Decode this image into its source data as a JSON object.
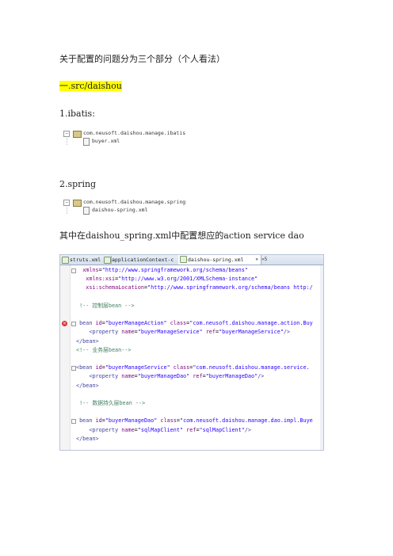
{
  "paragraphs": {
    "intro": "关于配置的问题分为三个部分（个人看法）",
    "section1": "一.src/daishou",
    "item1": "1.ibatis:",
    "item2": "2.spring",
    "note": "其中在daishou_spring.xml中配置想应的action service dao"
  },
  "ibatis_tree": {
    "package": "com.neusoft.daishou.manage.ibatis",
    "file": "buyer.xml"
  },
  "spring_tree": {
    "package": "com.neusoft.daishou.manage.spring",
    "file": "daishou-spring.xml"
  },
  "editor": {
    "tabs": [
      "struts.xml",
      "applicationContext-c",
      "daishou-spring.xml"
    ],
    "active_tab": 2,
    "overflow_count": "»5",
    "lines": [
      [
        {
          "c": "t-plain",
          "t": "  "
        },
        {
          "c": "t-attr",
          "t": "xmlns"
        },
        {
          "c": "t-plain",
          "t": "="
        },
        {
          "c": "t-val",
          "t": "\"http://www.springframework.org/schema/beans\""
        }
      ],
      [
        {
          "c": "t-plain",
          "t": "   "
        },
        {
          "c": "t-attr",
          "t": "xmlns:xsi"
        },
        {
          "c": "t-plain",
          "t": "="
        },
        {
          "c": "t-val",
          "t": "\"http://www.w3.org/2001/XMLSchema-instance\""
        }
      ],
      [
        {
          "c": "t-plain",
          "t": "   "
        },
        {
          "c": "t-attr",
          "t": "xsi:schemaLocation"
        },
        {
          "c": "t-plain",
          "t": "="
        },
        {
          "c": "t-val",
          "t": "\"http://www.springframework.org/schema/beans http:/"
        }
      ],
      [
        {
          "c": "t-plain",
          "t": ""
        }
      ],
      [
        {
          "c": "t-cmt",
          "t": " !-- 控制层bean -->"
        }
      ],
      [
        {
          "c": "t-plain",
          "t": ""
        }
      ],
      [
        {
          "c": "t-tag",
          "t": " bean "
        },
        {
          "c": "t-attr",
          "t": "id"
        },
        {
          "c": "t-plain",
          "t": "="
        },
        {
          "c": "t-val",
          "t": "\"buyerManageAction\""
        },
        {
          "c": "t-plain",
          "t": " "
        },
        {
          "c": "t-attr",
          "t": "class"
        },
        {
          "c": "t-plain",
          "t": "="
        },
        {
          "c": "t-val",
          "t": "\"com.neusoft.daishou.manage.action.Buy"
        }
      ],
      [
        {
          "c": "t-plain",
          "t": "    "
        },
        {
          "c": "t-tag",
          "t": "<property "
        },
        {
          "c": "t-attr",
          "t": "name"
        },
        {
          "c": "t-plain",
          "t": "="
        },
        {
          "c": "t-val",
          "t": "\"buyerManageService\""
        },
        {
          "c": "t-plain",
          "t": " "
        },
        {
          "c": "t-attr",
          "t": "ref"
        },
        {
          "c": "t-plain",
          "t": "="
        },
        {
          "c": "t-val",
          "t": "\"buyerManageService\""
        },
        {
          "c": "t-tag",
          "t": "/>"
        }
      ],
      [
        {
          "c": "t-tag",
          "t": "</bean>"
        }
      ],
      [
        {
          "c": "t-cmt",
          "t": "<!-- 业务层bean-->"
        }
      ],
      [
        {
          "c": "t-plain",
          "t": ""
        }
      ],
      [
        {
          "c": "t-tag",
          "t": "<bean "
        },
        {
          "c": "t-attr",
          "t": "id"
        },
        {
          "c": "t-plain",
          "t": "="
        },
        {
          "c": "t-val",
          "t": "\"buyerManageService\""
        },
        {
          "c": "t-plain",
          "t": " "
        },
        {
          "c": "t-attr",
          "t": "class"
        },
        {
          "c": "t-plain",
          "t": "="
        },
        {
          "c": "t-val",
          "t": "\"com.neusoft.daishou.manage.service."
        }
      ],
      [
        {
          "c": "t-plain",
          "t": "    "
        },
        {
          "c": "t-tag",
          "t": "<property "
        },
        {
          "c": "t-attr",
          "t": "name"
        },
        {
          "c": "t-plain",
          "t": "="
        },
        {
          "c": "t-val",
          "t": "\"buyerManageDao\""
        },
        {
          "c": "t-plain",
          "t": " "
        },
        {
          "c": "t-attr",
          "t": "ref"
        },
        {
          "c": "t-plain",
          "t": "="
        },
        {
          "c": "t-val",
          "t": "\"buyerManageDao\""
        },
        {
          "c": "t-tag",
          "t": "/>"
        }
      ],
      [
        {
          "c": "t-tag",
          "t": "</bean>"
        }
      ],
      [
        {
          "c": "t-plain",
          "t": ""
        }
      ],
      [
        {
          "c": "t-cmt",
          "t": " !-- 数据持久层bean -->"
        }
      ],
      [
        {
          "c": "t-plain",
          "t": ""
        }
      ],
      [
        {
          "c": "t-tag",
          "t": " bean "
        },
        {
          "c": "t-attr",
          "t": "id"
        },
        {
          "c": "t-plain",
          "t": "="
        },
        {
          "c": "t-val",
          "t": "\"buyerManageDao\""
        },
        {
          "c": "t-plain",
          "t": " "
        },
        {
          "c": "t-attr",
          "t": "class"
        },
        {
          "c": "t-plain",
          "t": "="
        },
        {
          "c": "t-val",
          "t": "\"com.neusoft.daishou.manage.dao.impl.Buye"
        }
      ],
      [
        {
          "c": "t-plain",
          "t": "    "
        },
        {
          "c": "t-tag",
          "t": "<property "
        },
        {
          "c": "t-attr",
          "t": "name"
        },
        {
          "c": "t-plain",
          "t": "="
        },
        {
          "c": "t-val",
          "t": "\"sqlMapClient\""
        },
        {
          "c": "t-plain",
          "t": " "
        },
        {
          "c": "t-attr",
          "t": "ref"
        },
        {
          "c": "t-plain",
          "t": "="
        },
        {
          "c": "t-val",
          "t": "\"sqlMapClient\""
        },
        {
          "c": "t-tag",
          "t": "/>"
        }
      ],
      [
        {
          "c": "t-tag",
          "t": "</bean>"
        }
      ],
      [
        {
          "c": "t-plain",
          "t": ""
        }
      ],
      [
        {
          "c": "t-tag",
          "t": "ns>"
        }
      ]
    ]
  }
}
